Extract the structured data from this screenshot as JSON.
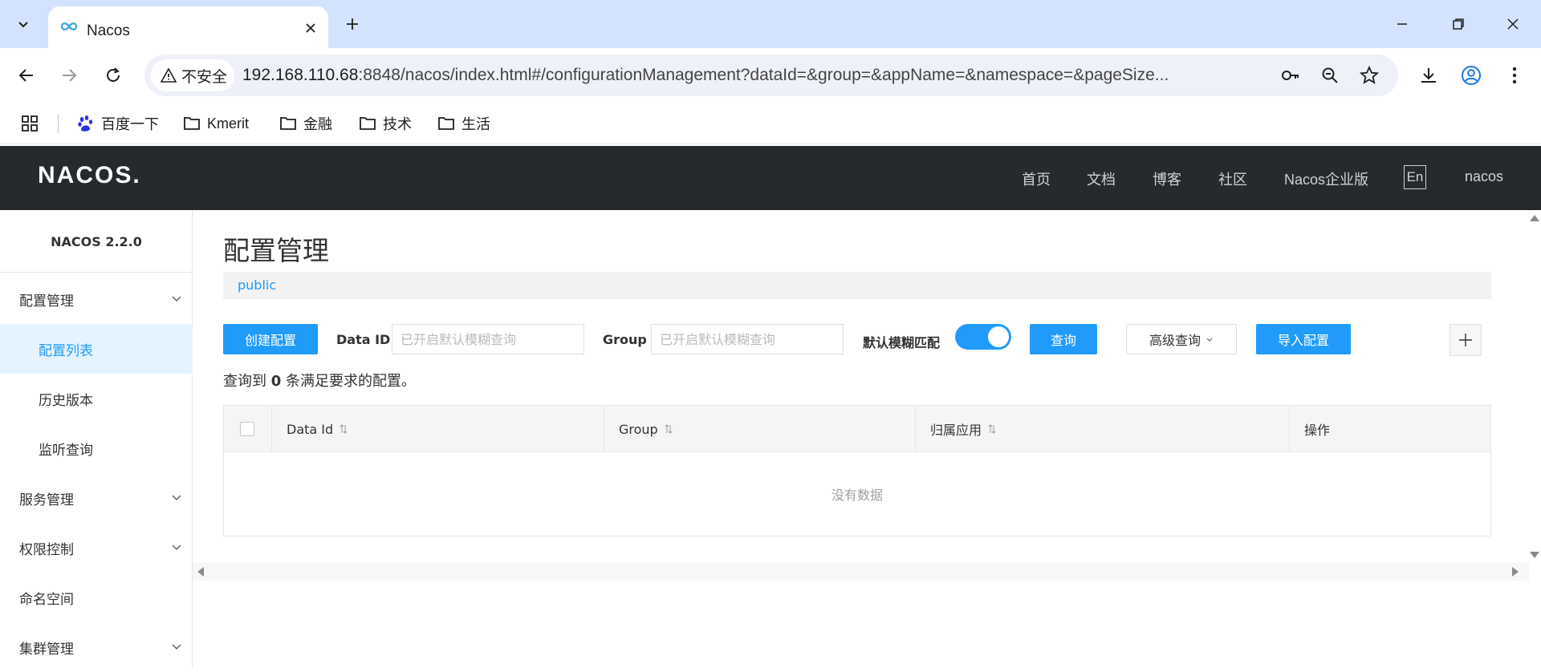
{
  "browser": {
    "tab_title": "Nacos",
    "security_label": "不安全",
    "url_host": "192.168.110.68",
    "url_rest": ":8848/nacos/index.html#/configurationManagement?dataId=&group=&appName=&namespace=&pageSize...",
    "bookmarks": [
      "百度一下",
      "Kmerit",
      "金融",
      "技术",
      "生活"
    ]
  },
  "header": {
    "logo": "NACOS.",
    "nav": [
      "首页",
      "文档",
      "博客",
      "社区",
      "Nacos企业版"
    ],
    "lang": "En",
    "user": "nacos"
  },
  "sidebar": {
    "version": "NACOS 2.2.0",
    "items": [
      {
        "label": "配置管理"
      },
      {
        "label": "配置列表"
      },
      {
        "label": "历史版本"
      },
      {
        "label": "监听查询"
      },
      {
        "label": "服务管理"
      },
      {
        "label": "权限控制"
      },
      {
        "label": "命名空间"
      },
      {
        "label": "集群管理"
      }
    ]
  },
  "main": {
    "title": "配置管理",
    "namespace": "public",
    "create_button": "创建配置",
    "data_id_label": "Data ID",
    "data_id_placeholder": "已开启默认模糊查询",
    "group_label": "Group",
    "group_placeholder": "已开启默认模糊查询",
    "fuzzy_label": "默认模糊匹配",
    "fuzzy_on": true,
    "query_button": "查询",
    "advanced_button": "高级查询",
    "import_button": "导入配置",
    "result_prefix": "查询到",
    "result_count": "0",
    "result_suffix": "条满足要求的配置。",
    "table": {
      "columns": [
        "Data Id",
        "Group",
        "归属应用",
        "操作"
      ],
      "empty_text": "没有数据"
    }
  },
  "colors": {
    "primary": "#209bfa",
    "header_bg": "#252a2f",
    "active_bg": "#e5f3ff"
  }
}
